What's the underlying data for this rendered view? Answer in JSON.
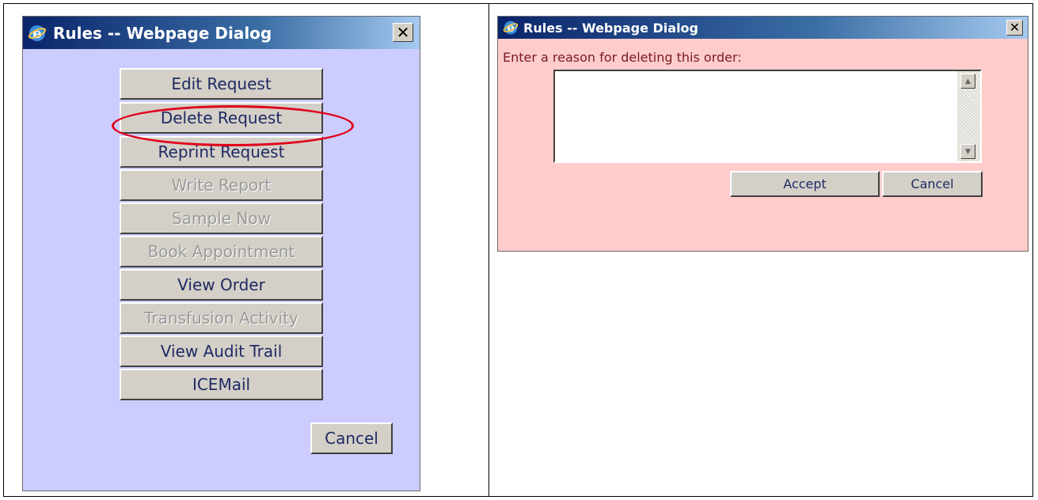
{
  "left_dialog": {
    "title": "Rules -- Webpage Dialog",
    "close_glyph": "✕",
    "background": "#ccccff",
    "buttons": [
      {
        "label": "Edit Request",
        "enabled": true
      },
      {
        "label": "Delete Request",
        "enabled": true,
        "highlighted": true
      },
      {
        "label": "Reprint Request",
        "enabled": true
      },
      {
        "label": "Write Report",
        "enabled": false
      },
      {
        "label": "Sample Now",
        "enabled": false
      },
      {
        "label": "Book Appointment",
        "enabled": false
      },
      {
        "label": "View Order",
        "enabled": true
      },
      {
        "label": "Transfusion Activity",
        "enabled": false
      },
      {
        "label": "View Audit Trail",
        "enabled": true
      },
      {
        "label": "ICEMail",
        "enabled": true
      }
    ],
    "cancel_label": "Cancel",
    "highlight_color": "#e0001a"
  },
  "right_dialog": {
    "title": "Rules -- Webpage Dialog",
    "close_glyph": "✕",
    "background": "#ffcccc",
    "prompt": "Enter a reason for deleting this order:",
    "reason_value": "",
    "accept_label": "Accept",
    "cancel_label": "Cancel"
  }
}
